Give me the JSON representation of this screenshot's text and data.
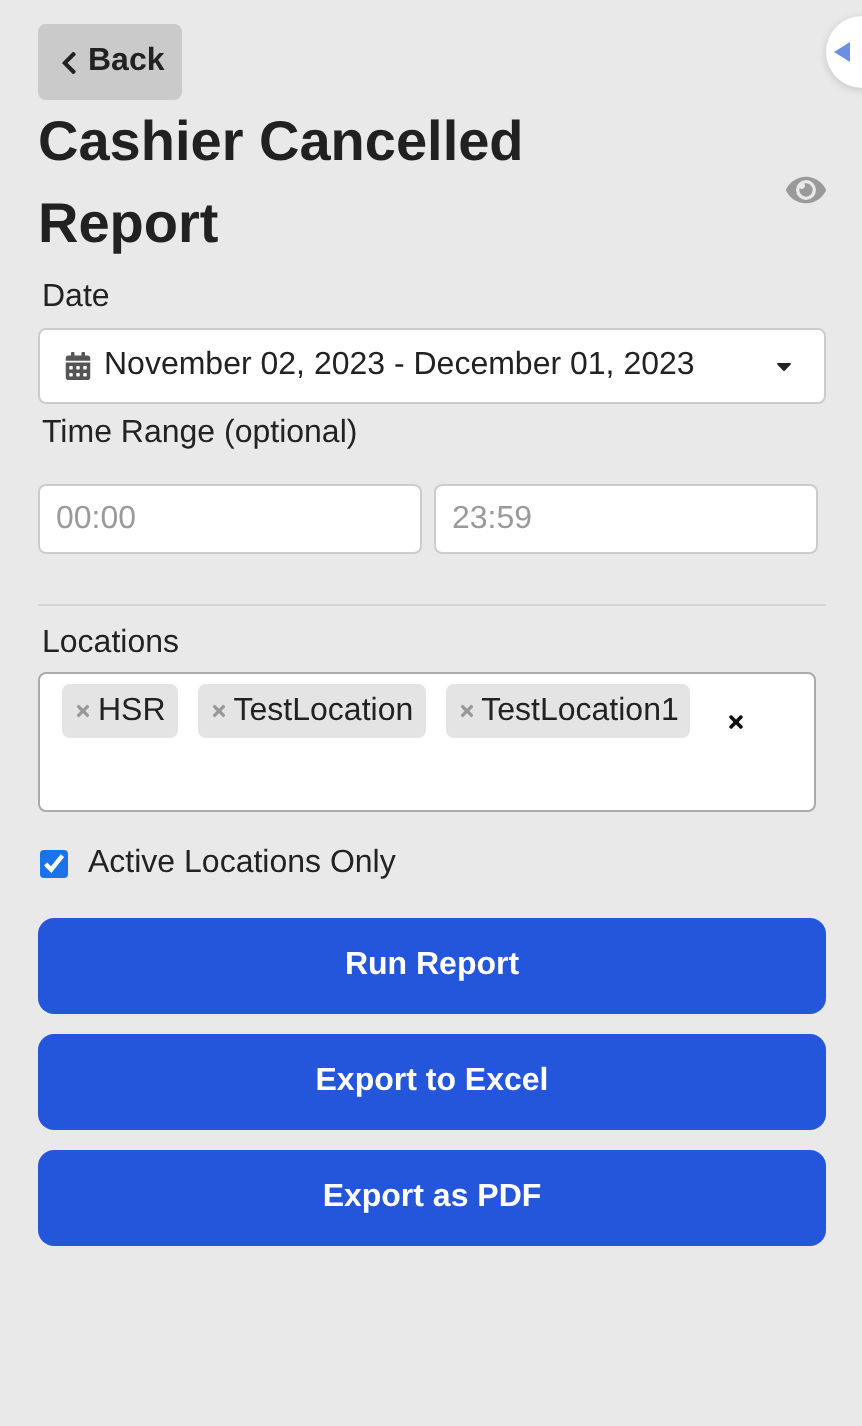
{
  "back_button": {
    "label": "Back"
  },
  "title": "Cashier Cancelled Report",
  "date": {
    "label": "Date",
    "value": "November 02, 2023 - December 01, 2023"
  },
  "time_range": {
    "label": "Time Range (optional)",
    "start_placeholder": "00:00",
    "end_placeholder": "23:59"
  },
  "locations": {
    "label": "Locations",
    "tags": [
      {
        "label": "HSR"
      },
      {
        "label": "TestLocation"
      },
      {
        "label": "TestLocation1"
      }
    ]
  },
  "active_only": {
    "label": "Active Locations Only",
    "checked": true
  },
  "buttons": [
    {
      "label": "Run Report"
    },
    {
      "label": "Export to Excel"
    },
    {
      "label": "Export as PDF"
    }
  ]
}
